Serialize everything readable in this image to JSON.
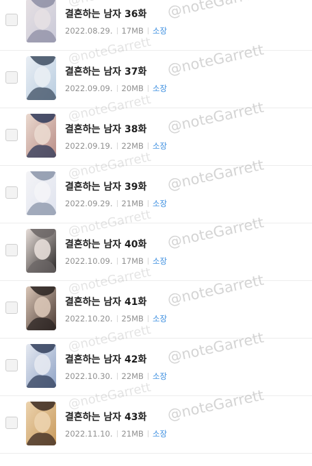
{
  "episodes": [
    {
      "title": "결혼하는 남자 36화",
      "date": "2022.08.29.",
      "size": "17MB",
      "status": "소장",
      "thumb_colors": [
        "#c9c9d8",
        "#8d8ea4",
        "#e6e0e3"
      ]
    },
    {
      "title": "결혼하는 남자 37화",
      "date": "2022.09.09.",
      "size": "20MB",
      "status": "소장",
      "thumb_colors": [
        "#b9cde0",
        "#3f4f63",
        "#e9eef4"
      ]
    },
    {
      "title": "결혼하는 남자 38화",
      "date": "2022.09.19.",
      "size": "22MB",
      "status": "소장",
      "thumb_colors": [
        "#b98d87",
        "#2f3a5a",
        "#ead9cf"
      ]
    },
    {
      "title": "결혼하는 남자 39화",
      "date": "2022.09.29.",
      "size": "21MB",
      "status": "소장",
      "thumb_colors": [
        "#dfe3ee",
        "#8a94a8",
        "#f4f4f7"
      ]
    },
    {
      "title": "결혼하는 남자 40화",
      "date": "2022.10.09.",
      "size": "17MB",
      "status": "소장",
      "thumb_colors": [
        "#2a2727",
        "#6b6565",
        "#e6ddd8"
      ]
    },
    {
      "title": "결혼하는 남자 41화",
      "date": "2022.10.20.",
      "size": "25MB",
      "status": "소장",
      "thumb_colors": [
        "#4a3a33",
        "#2a2321",
        "#d9c5b6"
      ]
    },
    {
      "title": "결혼하는 남자 42화",
      "date": "2022.10.30.",
      "size": "22MB",
      "status": "소장",
      "thumb_colors": [
        "#8fa3c6",
        "#33405c",
        "#e5e9f1"
      ]
    },
    {
      "title": "결혼하는 남자 43화",
      "date": "2022.11.10.",
      "size": "21MB",
      "status": "소장",
      "thumb_colors": [
        "#c89a5c",
        "#3b2a22",
        "#ecd3ae"
      ]
    }
  ],
  "watermark": "@noteGarrett",
  "colors": {
    "owned": "#3d8fe0",
    "divider": "#ececec",
    "meta": "#8f8f8f"
  }
}
